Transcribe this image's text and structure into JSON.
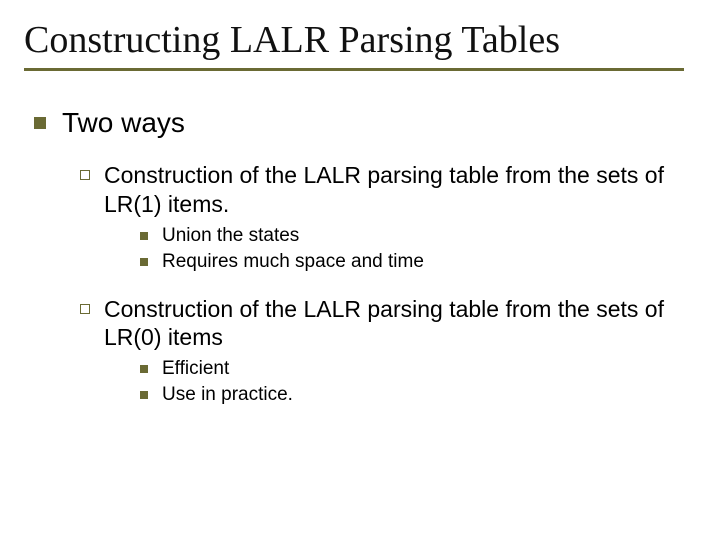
{
  "title": "Constructing LALR Parsing Tables",
  "main": {
    "heading": "Two ways",
    "points": [
      {
        "text": "Construction of the LALR parsing table from the sets of LR(1) items.",
        "sub": [
          "Union the states",
          "Requires much space and time"
        ]
      },
      {
        "text": "Construction of the LALR parsing table from the sets of LR(0) items",
        "sub": [
          "Efficient",
          "Use in practice."
        ]
      }
    ]
  }
}
